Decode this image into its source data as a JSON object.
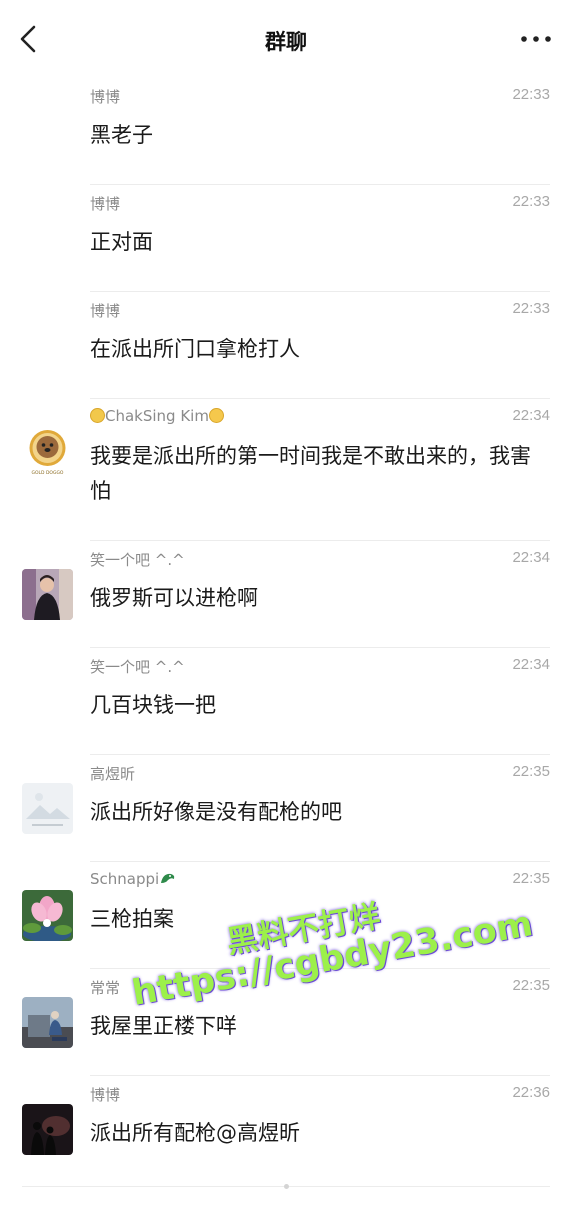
{
  "header": {
    "title": "群聊",
    "back_icon": "chevron-left-icon",
    "more_icon": "more-dots-icon"
  },
  "messages": [
    {
      "name": "博博",
      "time": "22:33",
      "text": "黑老子",
      "avatar": ""
    },
    {
      "name": "博博",
      "time": "22:33",
      "text": "正对面",
      "avatar": ""
    },
    {
      "name": "博博",
      "time": "22:33",
      "text": "在派出所门口拿枪打人",
      "avatar": ""
    },
    {
      "name": "ChakSing Kim",
      "time": "22:34",
      "text": "我要是派出所的第一时间我是不敢出来的，我害怕",
      "avatar": "dog-avatar",
      "avatar_text": "GOLD DOGGO"
    },
    {
      "name": "笑一个吧 ^.^",
      "time": "22:34",
      "text": "俄罗斯可以进枪啊",
      "avatar": "person-avatar"
    },
    {
      "name": "笑一个吧 ^.^",
      "time": "22:34",
      "text": "几百块钱一把",
      "avatar": ""
    },
    {
      "name": "高煜昕",
      "time": "22:35",
      "text": "派出所好像是没有配枪的吧",
      "avatar": "landscape-avatar"
    },
    {
      "name": "Schnappi",
      "time": "22:35",
      "text": "三枪拍案",
      "avatar": "flower-avatar"
    },
    {
      "name": "常常",
      "time": "22:35",
      "text": "我屋里正楼下咩",
      "avatar": "building-avatar"
    },
    {
      "name": "博博",
      "time": "22:36",
      "text": "派出所有配枪@高煜昕",
      "avatar": "silhouette-avatar"
    }
  ],
  "watermark": {
    "line1": "黑料不打烊",
    "line2": "https://cgbdy23.com"
  },
  "colors": {
    "text": "#1a1a1a",
    "name": "#8a8a8a",
    "time": "#a8a8a8",
    "separator": "#ececec",
    "watermark": "#9cf04a"
  }
}
